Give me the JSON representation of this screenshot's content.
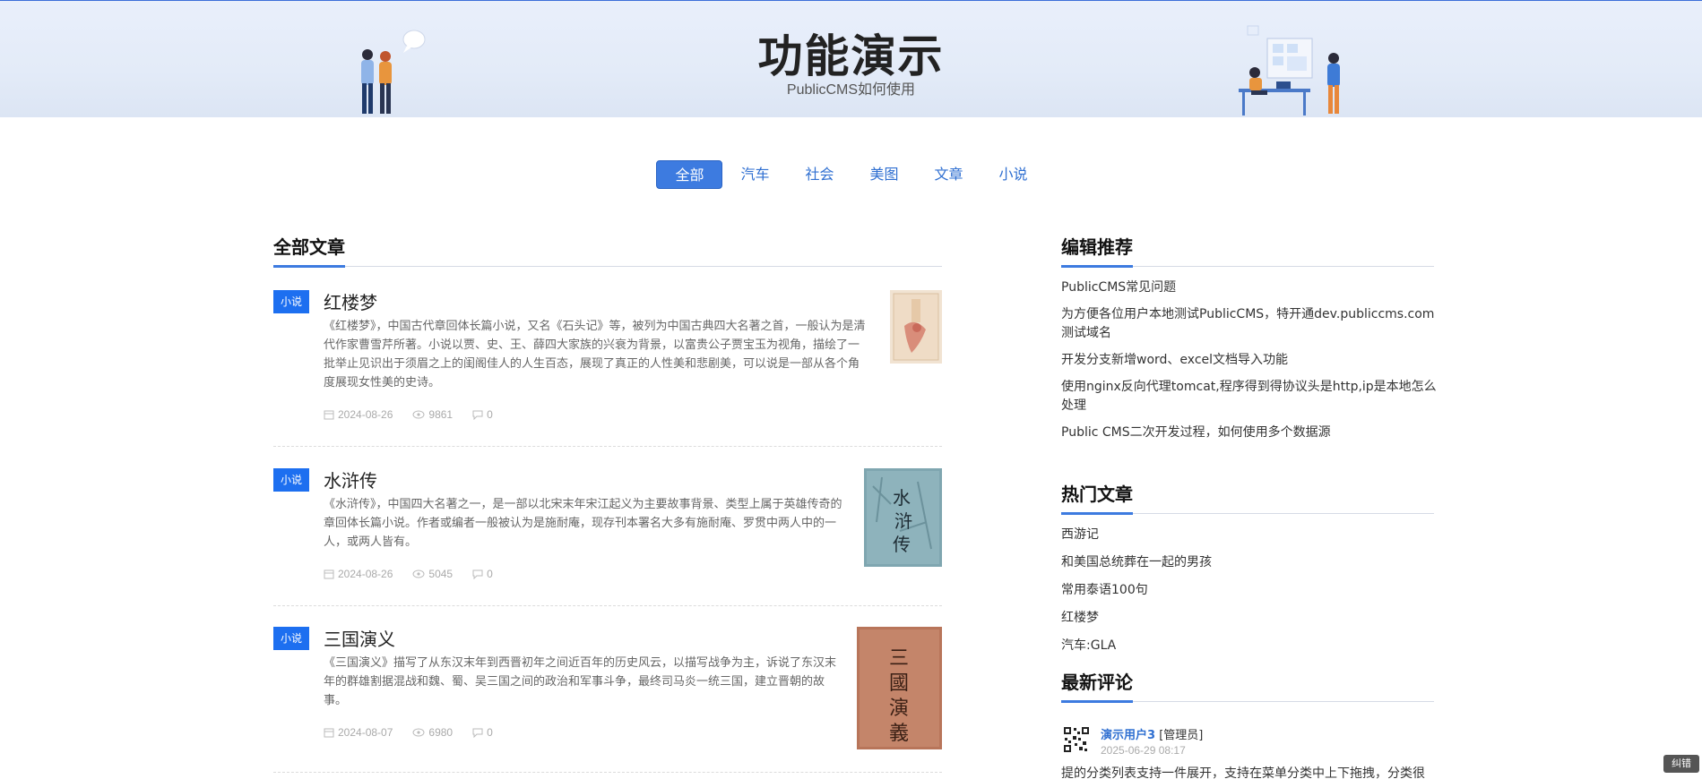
{
  "banner": {
    "title": "功能演示",
    "subtitle": "PublicCMS如何使用"
  },
  "tabs": [
    {
      "label": "全部",
      "active": true
    },
    {
      "label": "汽车",
      "active": false
    },
    {
      "label": "社会",
      "active": false
    },
    {
      "label": "美图",
      "active": false
    },
    {
      "label": "文章",
      "active": false
    },
    {
      "label": "小说",
      "active": false
    }
  ],
  "main": {
    "heading": "全部文章",
    "articles": [
      {
        "badge": "小说",
        "title": "红楼梦",
        "summary": "《红楼梦》，中国古代章回体长篇小说，又名《石头记》等，被列为中国古典四大名著之首，一般认为是清代作家曹雪芹所著。小说以贾、史、王、薛四大家族的兴衰为背景，以富贵公子贾宝玉为视角，描绘了一批举止见识出于须眉之上的闺阁佳人的人生百态，展现了真正的人性美和悲剧美，可以说是一部从各个角度展现女性美的史诗。",
        "date": "2024-08-26",
        "views": "9861",
        "comments": "0",
        "cover": "red-chamber-cover"
      },
      {
        "badge": "小说",
        "title": "水浒传",
        "summary": "《水浒传》，中国四大名著之一，是一部以北宋末年宋江起义为主要故事背景、类型上属于英雄传奇的章回体长篇小说。作者或编者一般被认为是施耐庵，现存刊本署名大多有施耐庵、罗贯中两人中的一人，或两人皆有。",
        "date": "2024-08-26",
        "views": "5045",
        "comments": "0",
        "cover": "water-margin-cover"
      },
      {
        "badge": "小说",
        "title": "三国演义",
        "summary": "《三国演义》描写了从东汉末年到西晋初年之间近百年的历史风云，以描写战争为主，诉说了东汉末年的群雄割据混战和魏、蜀、吴三国之间的政治和军事斗争，最终司马炎一统三国，建立晋朝的故事。",
        "date": "2024-08-07",
        "views": "6980",
        "comments": "0",
        "cover": "three-kingdoms-cover"
      }
    ]
  },
  "sidebar": {
    "editor_heading": "编辑推荐",
    "editor_items": [
      "PublicCMS常见问题",
      "为方便各位用户本地测试PublicCMS，特开通dev.publiccms.com测试域名",
      "开发分支新增word、excel文档导入功能",
      "使用nginx反向代理tomcat,程序得到得协议头是http,ip是本地怎么处理",
      "Public CMS二次开发过程，如何使用多个数据源"
    ],
    "hot_heading": "热门文章",
    "hot_items": [
      "西游记",
      "和美国总统葬在一起的男孩",
      "常用泰语100句",
      "红楼梦",
      "汽车:GLA"
    ],
    "comments_heading": "最新评论",
    "comment": {
      "user": "演示用户3",
      "role": "[管理员]",
      "time": "2025-06-29 08:17",
      "text": "提的分类列表支持一件展开，支持在菜单分类中上下拖拽，分类很"
    }
  },
  "corner_button": "纠错",
  "colors": {
    "accent": "#3d7be0",
    "badge": "#1d6ff0",
    "banner_bg": "#e6edf9"
  }
}
